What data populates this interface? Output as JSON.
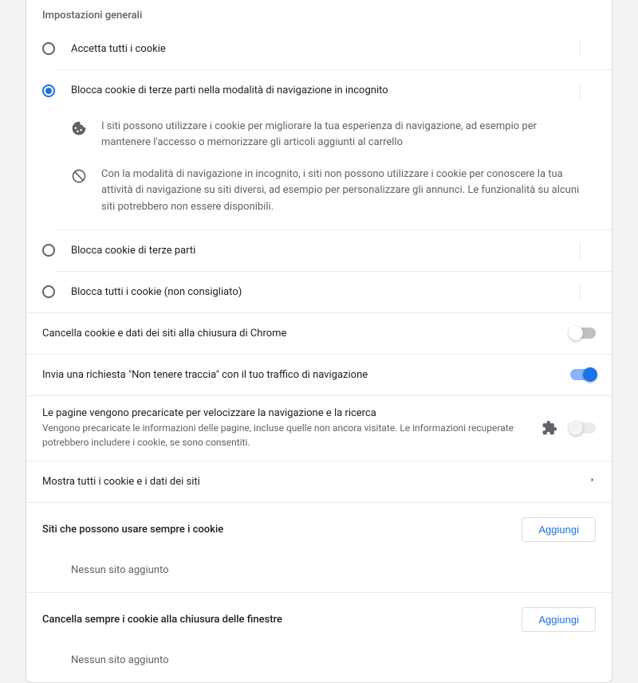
{
  "section_title": "Impostazioni generali",
  "options": [
    {
      "label": "Accetta tutti i cookie",
      "selected": false,
      "expanded": false
    },
    {
      "label": "Blocca cookie di terze parti nella modalità di navigazione in incognito",
      "selected": true,
      "expanded": true
    },
    {
      "label": "Blocca cookie di terze parti",
      "selected": false,
      "expanded": false
    },
    {
      "label": "Blocca tutti i cookie (non consigliato)",
      "selected": false,
      "expanded": false
    }
  ],
  "expanded_desc": {
    "line1": "I siti possono utilizzare i cookie per migliorare la tua esperienza di navigazione, ad esempio per mantenere l'accesso o memorizzare gli articoli aggiunti al carrello",
    "line2": "Con la modalità di navigazione in incognito, i siti non possono utilizzare i cookie per conoscere la tua attività di navigazione su siti diversi, ad esempio per personalizzare gli annunci. Le funzionalità su alcuni siti potrebbero non essere disponibili."
  },
  "settings": {
    "clear_on_exit": {
      "label": "Cancella cookie e dati dei siti alla chiusura di Chrome",
      "on": false
    },
    "do_not_track": {
      "label": "Invia una richiesta \"Non tenere traccia\" con il tuo traffico di navigazione",
      "on": true
    },
    "preload": {
      "label": "Le pagine vengono precaricate per velocizzare la navigazione e la ricerca",
      "sub": "Vengono precaricate le informazioni delle pagine, incluse quelle non ancora visitate. Le informazioni recuperate potrebbero includere i cookie, se sono consentiti.",
      "on": false,
      "disabled": true
    },
    "show_all": {
      "label": "Mostra tutti i cookie e i dati dei siti"
    }
  },
  "site_sections": {
    "allow": {
      "title": "Siti che possono usare sempre i cookie",
      "button": "Aggiungi",
      "empty": "Nessun sito aggiunto"
    },
    "clear": {
      "title": "Cancella sempre i cookie alla chiusura delle finestre",
      "button": "Aggiungi",
      "empty": "Nessun sito aggiunto"
    }
  }
}
